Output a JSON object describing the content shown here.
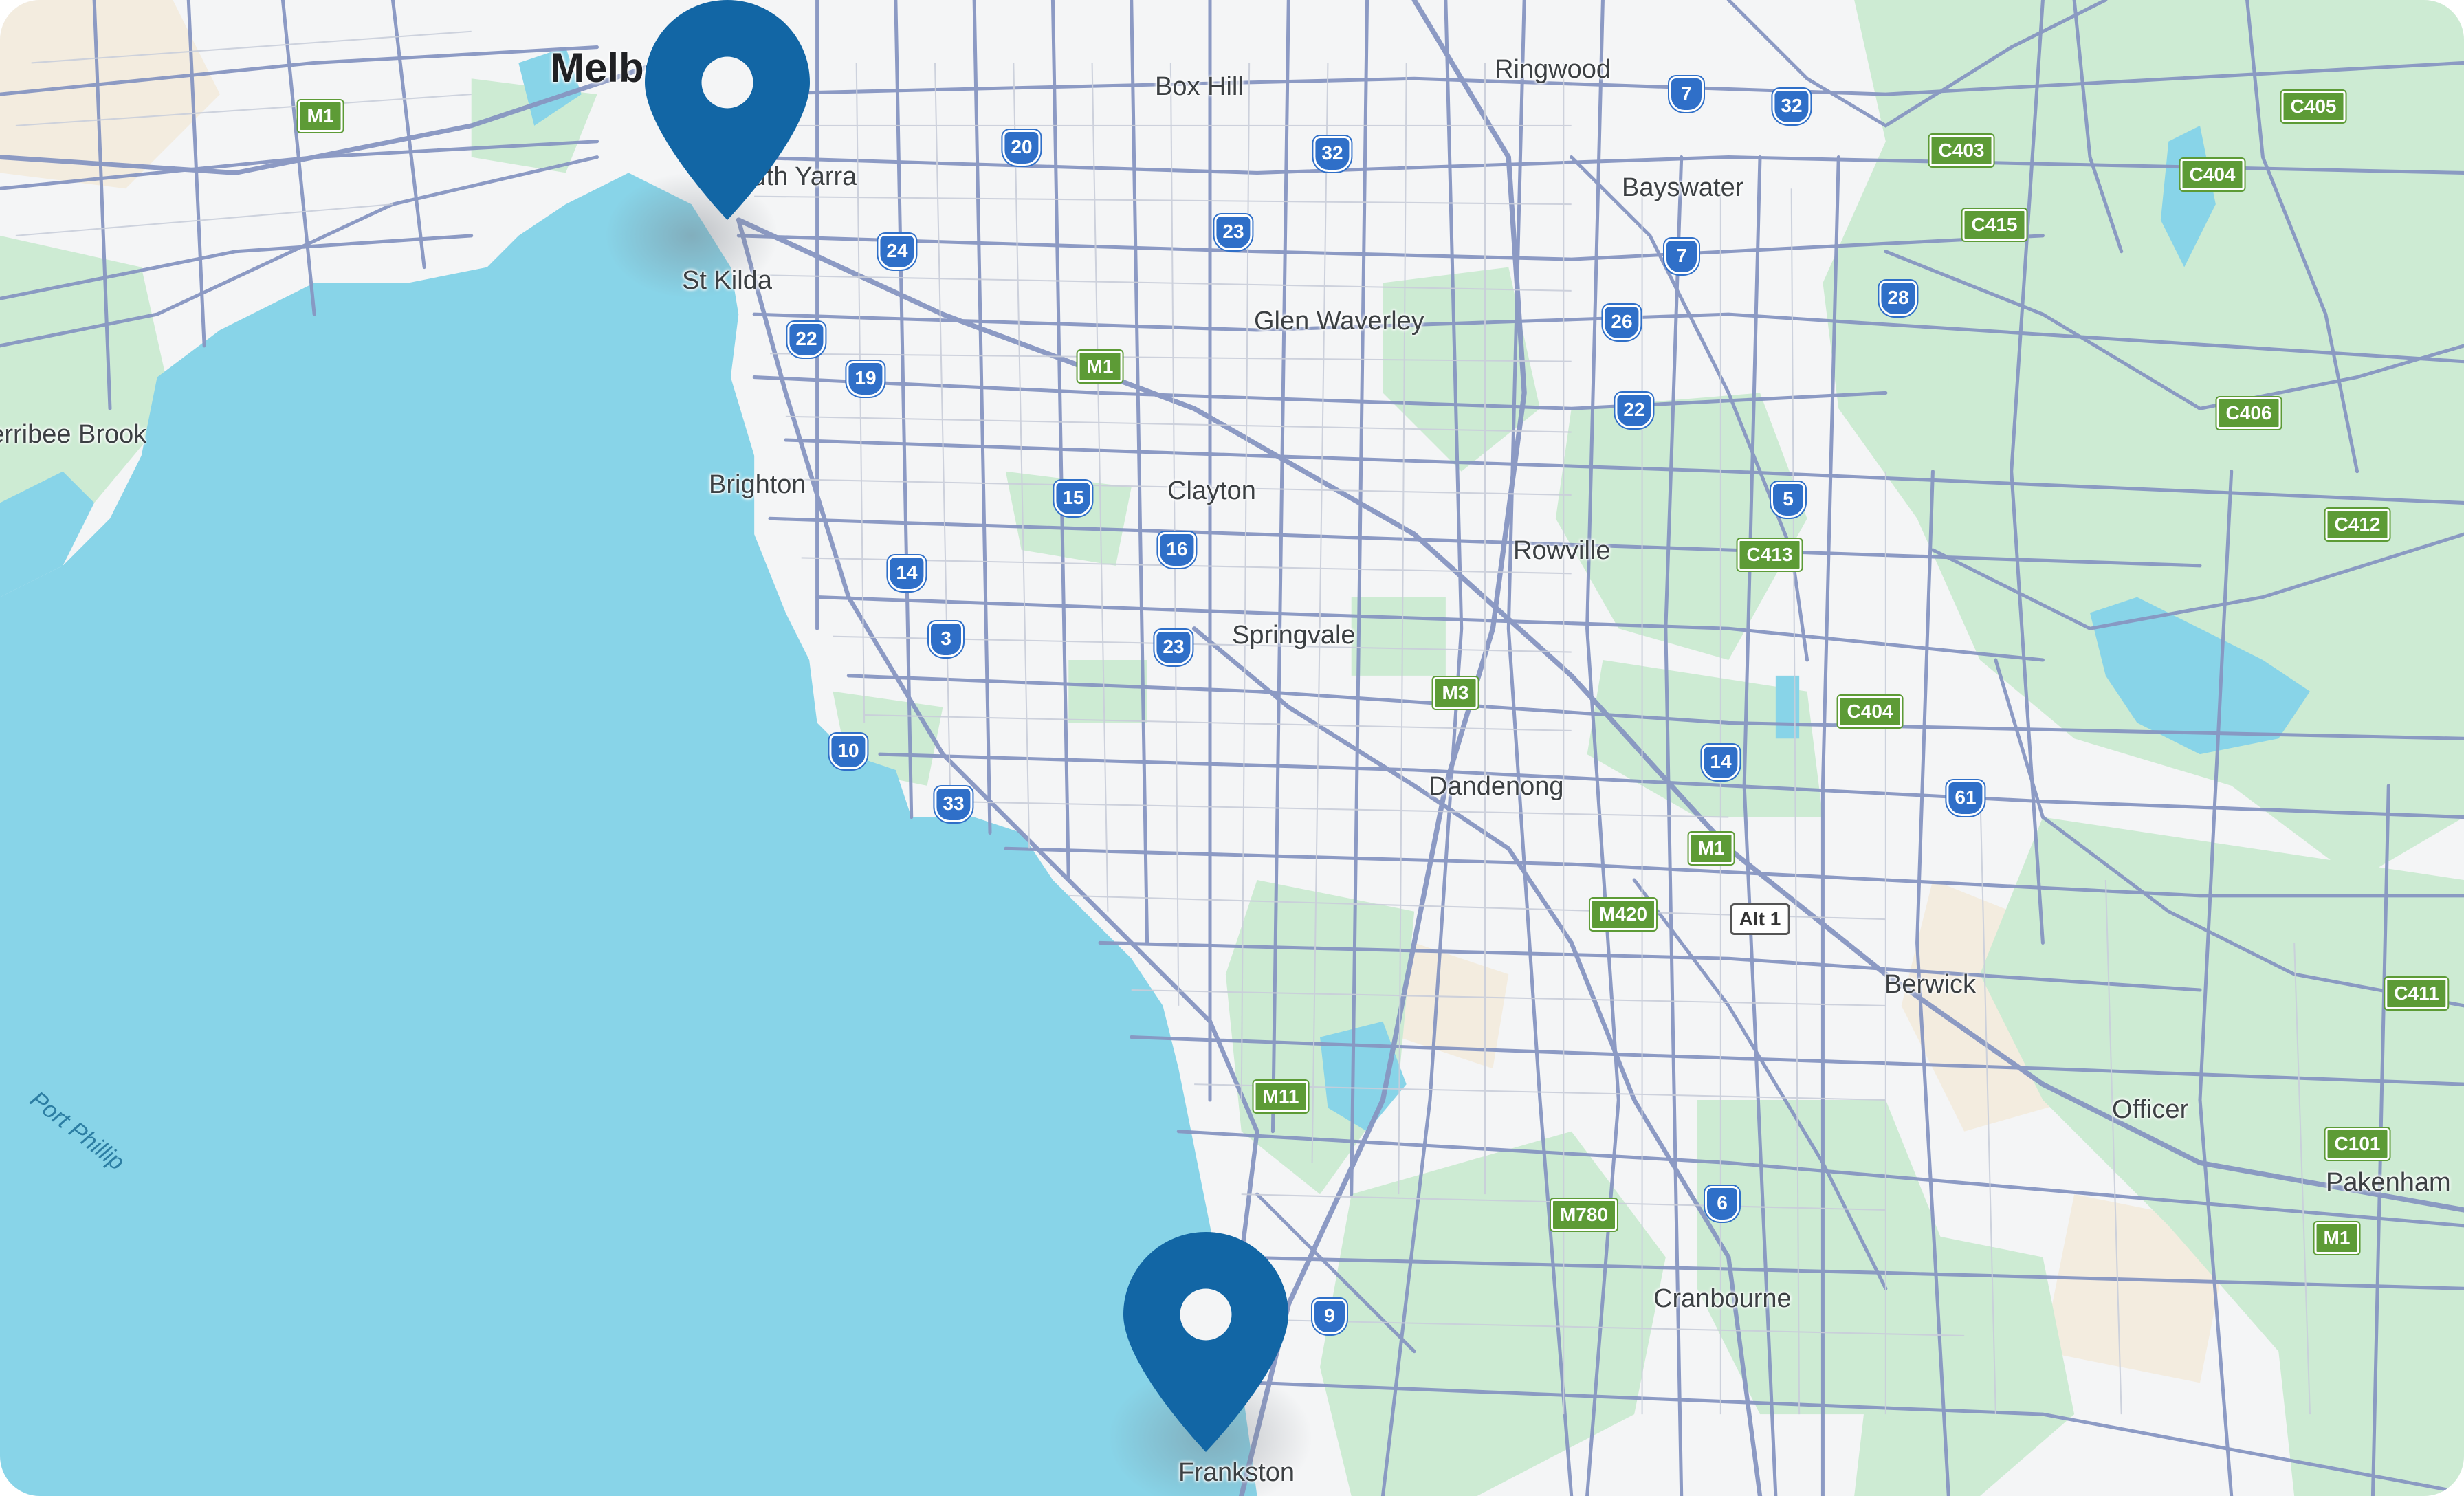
{
  "map": {
    "colors": {
      "water": "#88d4e8",
      "land": "#f4f5f6",
      "park": "#cdebd3",
      "road": "#8796c2",
      "marker": "#1266a5",
      "metro_shield": "#2f6fc8",
      "state_shield": "#5d9b36"
    },
    "places": [
      {
        "name": "Melbourne",
        "class": "major"
      },
      {
        "name": "South Yarra",
        "class": ""
      },
      {
        "name": "St Kilda",
        "class": ""
      },
      {
        "name": "Box Hill",
        "class": ""
      },
      {
        "name": "Ringwood",
        "class": ""
      },
      {
        "name": "Bayswater",
        "class": ""
      },
      {
        "name": "Glen Waverley",
        "class": ""
      },
      {
        "name": "Brighton",
        "class": ""
      },
      {
        "name": "Clayton",
        "class": ""
      },
      {
        "name": "Rowville",
        "class": ""
      },
      {
        "name": "Springvale",
        "class": ""
      },
      {
        "name": "Dandenong",
        "class": ""
      },
      {
        "name": "Berwick",
        "class": ""
      },
      {
        "name": "Officer",
        "class": ""
      },
      {
        "name": "Pakenham",
        "class": ""
      },
      {
        "name": "Cranbourne",
        "class": ""
      },
      {
        "name": "Frankston",
        "class": ""
      },
      {
        "name": "Werribee Brook",
        "class": ""
      }
    ],
    "water_label": "Port Phillip",
    "shields": [
      {
        "text": "M1",
        "type": "state"
      },
      {
        "text": "20",
        "type": "metro"
      },
      {
        "text": "32",
        "type": "metro"
      },
      {
        "text": "7",
        "type": "metro"
      },
      {
        "text": "32",
        "type": "metro"
      },
      {
        "text": "C405",
        "type": "state"
      },
      {
        "text": "C403",
        "type": "state"
      },
      {
        "text": "C404",
        "type": "state"
      },
      {
        "text": "C415",
        "type": "state"
      },
      {
        "text": "24",
        "type": "metro"
      },
      {
        "text": "23",
        "type": "metro"
      },
      {
        "text": "7",
        "type": "metro"
      },
      {
        "text": "28",
        "type": "metro"
      },
      {
        "text": "22",
        "type": "metro"
      },
      {
        "text": "19",
        "type": "metro"
      },
      {
        "text": "M1",
        "type": "state"
      },
      {
        "text": "26",
        "type": "metro"
      },
      {
        "text": "22",
        "type": "metro"
      },
      {
        "text": "C406",
        "type": "state"
      },
      {
        "text": "15",
        "type": "metro"
      },
      {
        "text": "5",
        "type": "metro"
      },
      {
        "text": "C412",
        "type": "state"
      },
      {
        "text": "16",
        "type": "metro"
      },
      {
        "text": "C413",
        "type": "state"
      },
      {
        "text": "14",
        "type": "metro"
      },
      {
        "text": "3",
        "type": "metro"
      },
      {
        "text": "23",
        "type": "metro"
      },
      {
        "text": "M3",
        "type": "state"
      },
      {
        "text": "C404",
        "type": "state"
      },
      {
        "text": "10",
        "type": "metro"
      },
      {
        "text": "14",
        "type": "metro"
      },
      {
        "text": "33",
        "type": "metro"
      },
      {
        "text": "61",
        "type": "metro"
      },
      {
        "text": "M1",
        "type": "state"
      },
      {
        "text": "M420",
        "type": "state"
      },
      {
        "text": "Alt 1",
        "type": "alt"
      },
      {
        "text": "C411",
        "type": "state"
      },
      {
        "text": "M11",
        "type": "state"
      },
      {
        "text": "C101",
        "type": "state"
      },
      {
        "text": "M780",
        "type": "state"
      },
      {
        "text": "6",
        "type": "metro"
      },
      {
        "text": "M1",
        "type": "state"
      },
      {
        "text": "9",
        "type": "metro"
      }
    ],
    "markers": [
      {
        "name": "location-pin-melbourne"
      },
      {
        "name": "location-pin-frankston"
      }
    ]
  }
}
